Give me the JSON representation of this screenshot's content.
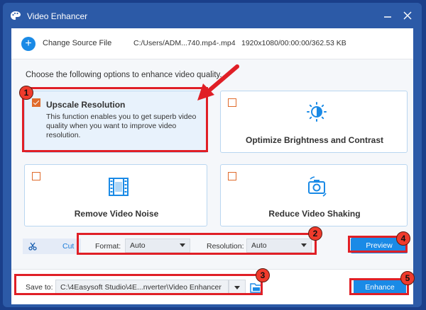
{
  "window": {
    "title": "Video Enhancer",
    "app_icon": "palette-icon",
    "minimize_icon": "minimize-icon",
    "close_icon": "close-icon"
  },
  "source": {
    "add_icon": "plus-icon",
    "change_label": "Change Source File",
    "path": "C:/Users/ADM...740.mp4-.mp4",
    "info": "1920x1080/00:00:00/362.53 KB"
  },
  "intro": "Choose the following options to enhance video quality.",
  "options": [
    {
      "title": "Upscale Resolution",
      "description": "This function enables you to get superb video quality when you want to improve video resolution.",
      "checked": true
    },
    {
      "title": "Optimize Brightness and Contrast",
      "icon": "brightness-icon",
      "checked": false
    },
    {
      "title": "Remove Video Noise",
      "icon": "film-icon",
      "checked": false
    },
    {
      "title": "Reduce Video Shaking",
      "icon": "camera-rotate-icon",
      "checked": false
    }
  ],
  "settings": {
    "cut_label": "Cut",
    "cut_icon": "scissors-icon",
    "format_label": "Format:",
    "format_value": "Auto",
    "resolution_label": "Resolution:",
    "resolution_value": "Auto",
    "preview_label": "Preview"
  },
  "save": {
    "label": "Save to:",
    "path": "C:\\4Easysoft Studio\\4E...nverter\\Video Enhancer",
    "folder_icon": "folder-icon",
    "enhance_label": "Enhance"
  },
  "annotations": {
    "badges": [
      "1",
      "2",
      "3",
      "4",
      "5"
    ],
    "highlight_color": "#e01f26",
    "accent_color": "#1a8ae6",
    "checkbox_color": "#e06b2c"
  }
}
